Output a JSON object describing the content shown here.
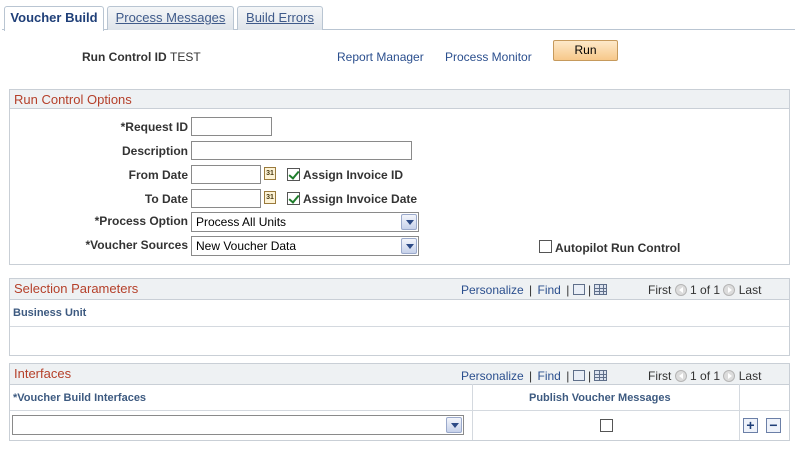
{
  "tabs": [
    {
      "label": "Voucher Build",
      "active": true
    },
    {
      "label": "Process Messages",
      "active": false
    },
    {
      "label": "Build Errors",
      "active": false
    }
  ],
  "header": {
    "run_control_label": "Run Control ID",
    "run_control_value": "TEST",
    "report_manager": "Report Manager",
    "process_monitor": "Process Monitor",
    "run_button": "Run"
  },
  "run_control_options": {
    "title": "Run Control Options",
    "request_id_label": "*Request ID",
    "request_id_value": "",
    "description_label": "Description",
    "description_value": "",
    "from_date_label": "From Date",
    "from_date_value": "",
    "to_date_label": "To Date",
    "to_date_value": "",
    "calendar_glyph": "31",
    "assign_invoice_id_label": "Assign Invoice ID",
    "assign_invoice_id_checked": true,
    "assign_invoice_date_label": "Assign Invoice Date",
    "assign_invoice_date_checked": true,
    "process_option_label": "*Process Option",
    "process_option_value": "Process All Units",
    "voucher_sources_label": "*Voucher Sources",
    "voucher_sources_value": "New Voucher Data",
    "autopilot_label": "Autopilot Run Control",
    "autopilot_checked": false
  },
  "selection_parameters": {
    "title": "Selection Parameters",
    "personalize": "Personalize",
    "separator": "|",
    "find": "Find",
    "first": "First",
    "range": "1 of 1",
    "last": "Last",
    "column_business_unit": "Business Unit"
  },
  "interfaces": {
    "title": "Interfaces",
    "personalize": "Personalize",
    "separator": "|",
    "find": "Find",
    "first": "First",
    "range": "1 of 1",
    "last": "Last",
    "column_interfaces": "*Voucher Build Interfaces",
    "column_publish": "Publish Voucher Messages",
    "interface_value": "",
    "publish_checked": false,
    "add_symbol": "+",
    "remove_symbol": "−"
  },
  "icons": [
    "calendar-icon",
    "view-all-icon",
    "grid-download-icon",
    "first-arrow-icon",
    "next-arrow-icon",
    "add-row-icon",
    "delete-row-icon",
    "dropdown-arrow-icon"
  ]
}
